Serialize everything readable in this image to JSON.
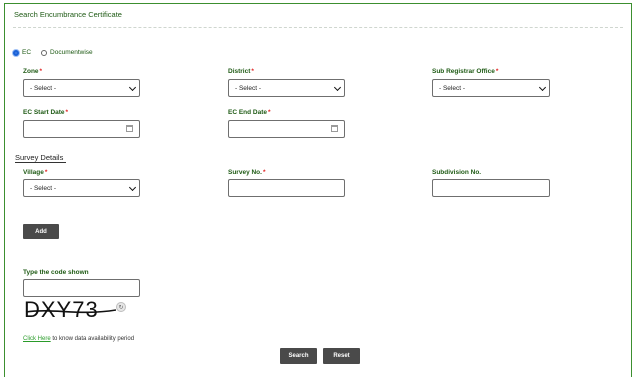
{
  "title": "Search Encumbrance Certificate",
  "radio": [
    {
      "label": "EC",
      "checked": true
    },
    {
      "label": "Documentwise",
      "checked": false
    }
  ],
  "zone": {
    "label": "Zone",
    "value": "- Select -"
  },
  "district": {
    "label": "District",
    "value": "- Select -"
  },
  "sro": {
    "label": "Sub Registrar Office",
    "value": "- Select -"
  },
  "ec_start": {
    "label": "EC Start Date",
    "value": ""
  },
  "ec_end": {
    "label": "EC End Date",
    "value": ""
  },
  "survey_section": "Survey Details",
  "village": {
    "label": "Village",
    "value": "- Select -"
  },
  "survey_no": {
    "label": "Survey No.",
    "value": ""
  },
  "subdivision": {
    "label": "Subdivision No.",
    "value": ""
  },
  "required_mark": "*",
  "buttons": {
    "add": "Add",
    "search": "Search",
    "reset": "Reset"
  },
  "captcha": {
    "label": "Type the code shown",
    "value": "",
    "code": "DXY73"
  },
  "info": {
    "link": "Click Here",
    "text": " to know data availability period"
  },
  "colors": {
    "accent": "#1e5a14",
    "border": "#3c8f2f",
    "button": "#4a4a4a",
    "link": "#2a9b2a"
  },
  "icons": {
    "refresh": "refresh-icon",
    "calendar": "calendar-icon",
    "dropdown": "chevron-down-icon"
  }
}
